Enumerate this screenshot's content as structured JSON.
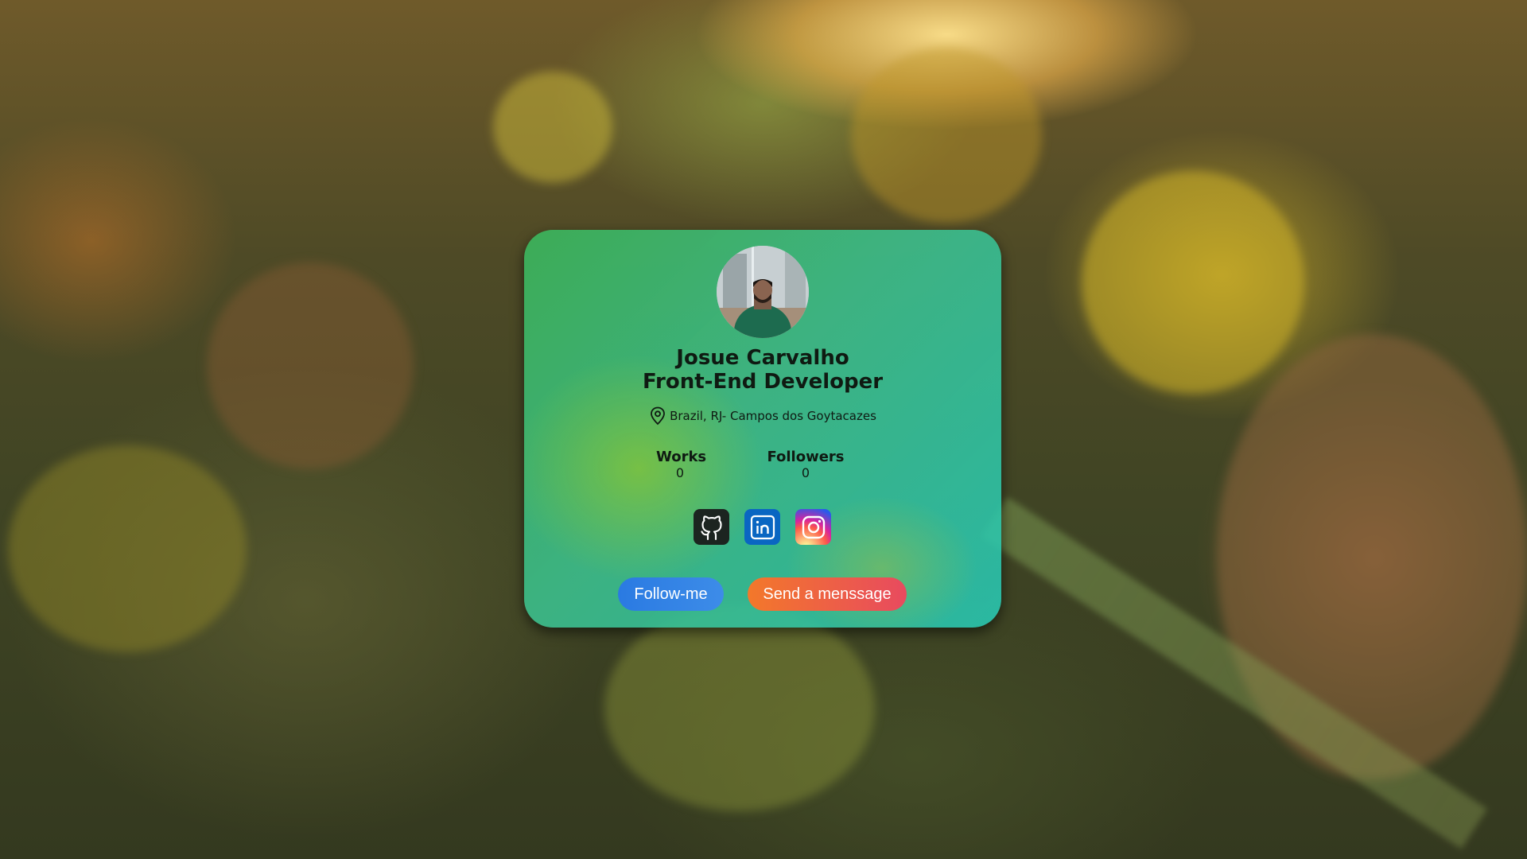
{
  "profile": {
    "name": "Josue Carvalho",
    "role": "Front-End Developer",
    "location": "Brazil, RJ- Campos dos Goytacazes"
  },
  "stats": [
    {
      "label": "Works",
      "value": "0"
    },
    {
      "label": "Followers",
      "value": "0"
    }
  ],
  "socials": [
    {
      "name": "github",
      "icon": "github-icon",
      "color": "#1c2420"
    },
    {
      "name": "linkedin",
      "icon": "linkedin-icon",
      "color": "#0a66c2"
    },
    {
      "name": "instagram",
      "icon": "instagram-icon",
      "color": "#e1306c"
    }
  ],
  "actions": {
    "follow_label": "Follow-me",
    "message_label": "Send a menssage"
  },
  "colors": {
    "follow_button": "#2a7ae2",
    "message_button": "#ef6a3f"
  }
}
